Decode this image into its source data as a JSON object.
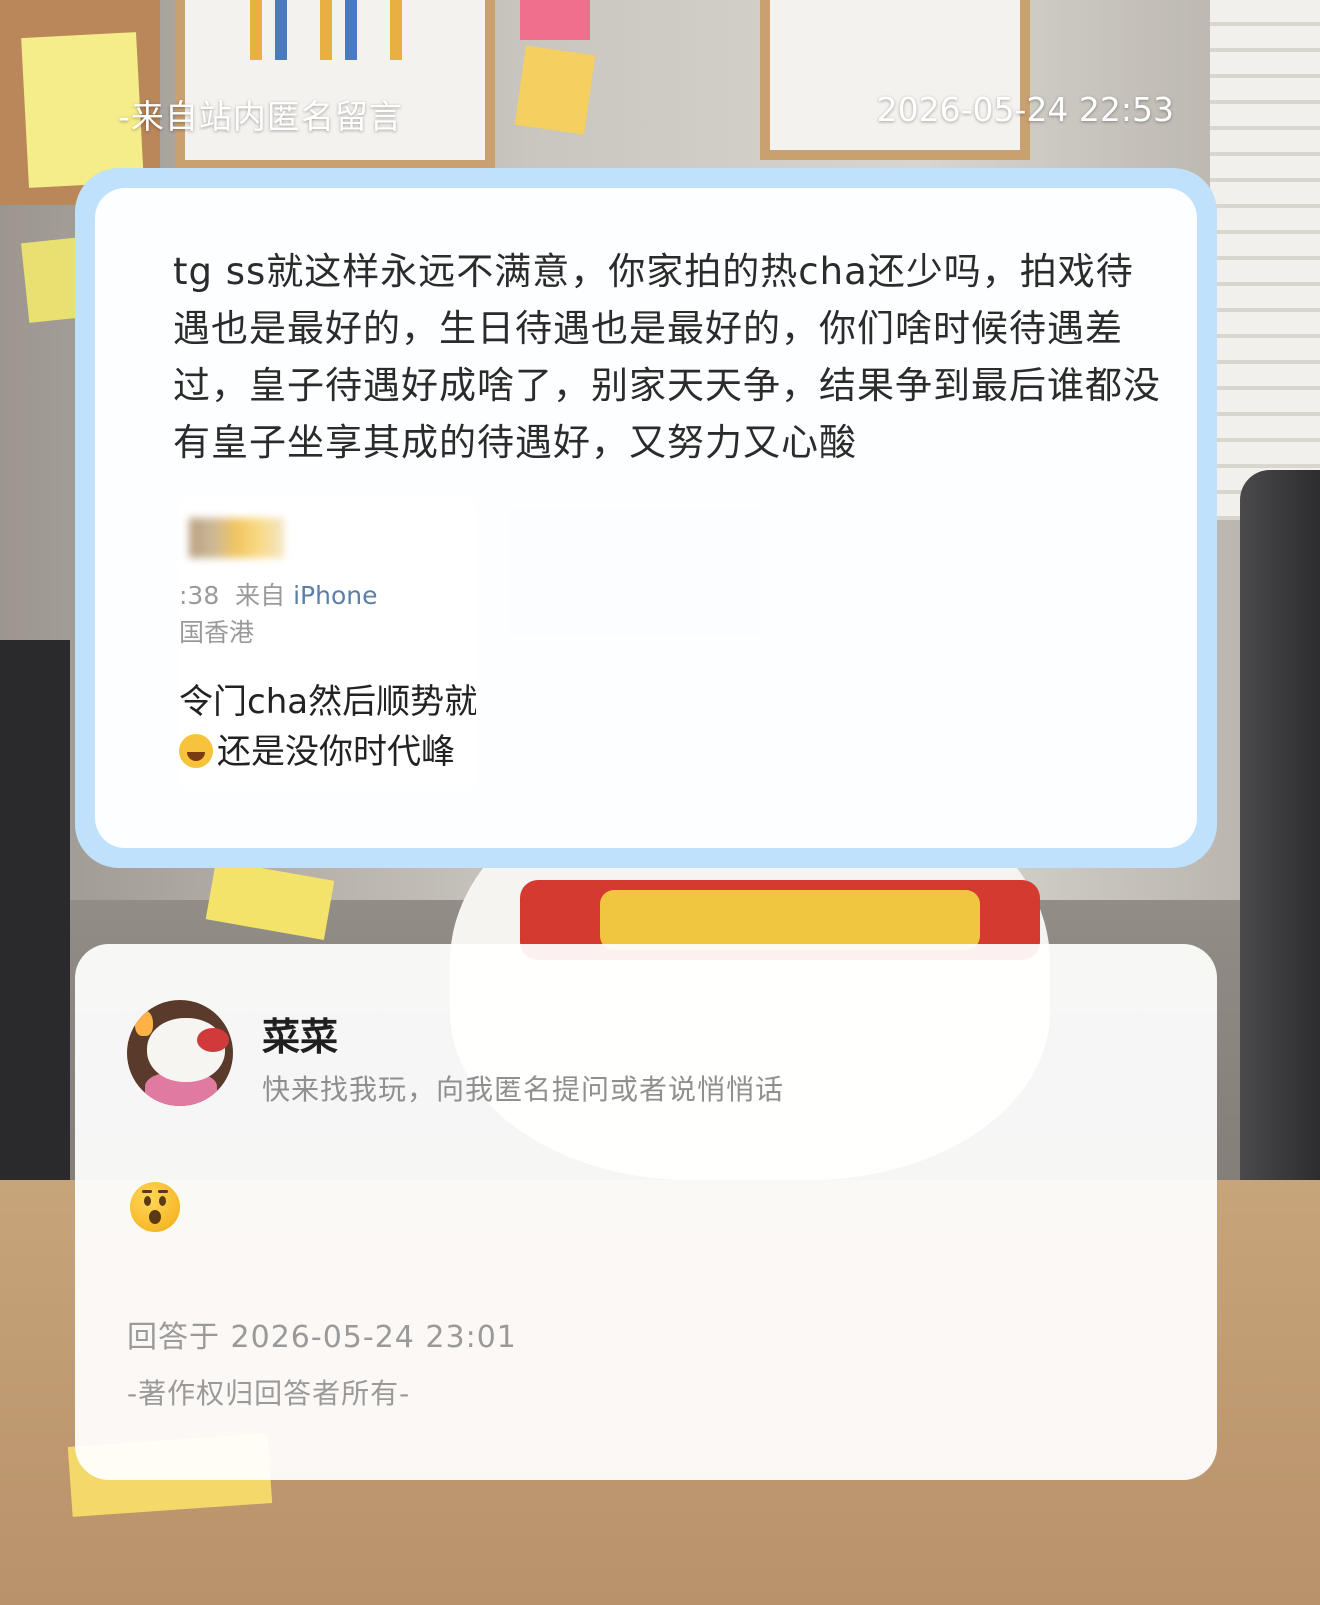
{
  "header": {
    "source": "-来自站内匿名留言",
    "timestamp": "2026-05-24 22:53"
  },
  "question": {
    "text": "tg ss就这样永远不满意，你家拍的热cha还少吗，拍戏待遇也是最好的，生日待遇也是最好的，你们啥时候待遇差过，皇子待遇好成啥了，别家天天争，结果争到最后谁都没有皇子坐享其成的待遇好，又努力又心酸",
    "attached_screenshot": {
      "time_prefix": ":38",
      "from_label": "来自",
      "device": "iPhone",
      "location": "国香港",
      "line1": "令门cha然后顺势就",
      "line2": "还是没你时代峰"
    }
  },
  "answer": {
    "username": "菜菜",
    "bio": "快来找我玩，向我匿名提问或者说悄悄话",
    "emoji_icon": "astonished-face-emoji",
    "answered_at": "回答于 2026-05-24 23:01",
    "copyright": "-著作权归回答者所有-"
  },
  "colors": {
    "card_border": "#bfe1fb",
    "device_link": "#5b7fa8"
  }
}
